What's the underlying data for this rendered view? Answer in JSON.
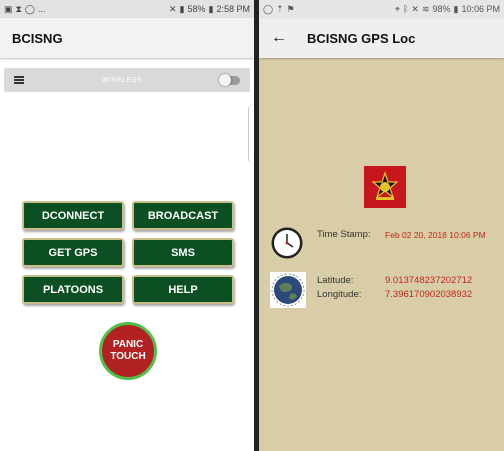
{
  "left_screen": {
    "status_bar": {
      "left_text": "...",
      "battery": "58%",
      "time": "2:58 PM"
    },
    "app_title": "BCISNG",
    "wireless_bar": {
      "label": "WIRELESS"
    },
    "buttons": {
      "dconnect": "DCONNECT",
      "broadcast": "BROADCAST",
      "get_gps": "GET GPS",
      "sms": "SMS",
      "platoons": "PLATOONS",
      "help": "HELP"
    },
    "panic": {
      "line1": "PANIC",
      "line2": "TOUCH"
    }
  },
  "right_screen": {
    "status_bar": {
      "battery": "98%",
      "time": "10:06 PM"
    },
    "app_title": "BCISNG GPS Loc",
    "time_stamp_label": "Time Stamp:",
    "time_stamp_value": "Feb 02 20, 2018 10:06 PM",
    "latitude_label": "Latitude:",
    "latitude_value": "9.013748237202712",
    "longitude_label": "Longitude:",
    "longitude_value": "7.396170902038932"
  },
  "colors": {
    "button_green": "#0b4f22",
    "button_border": "#c9bd8a",
    "panic_red": "#b22222",
    "panic_ring": "#4fc04a",
    "gps_background": "#d8cda6",
    "value_red": "#c0261e"
  },
  "icons": [
    "menu-icon",
    "toggle-switch",
    "back-arrow-icon",
    "army-emblem-icon",
    "clock-icon",
    "globe-icon"
  ]
}
